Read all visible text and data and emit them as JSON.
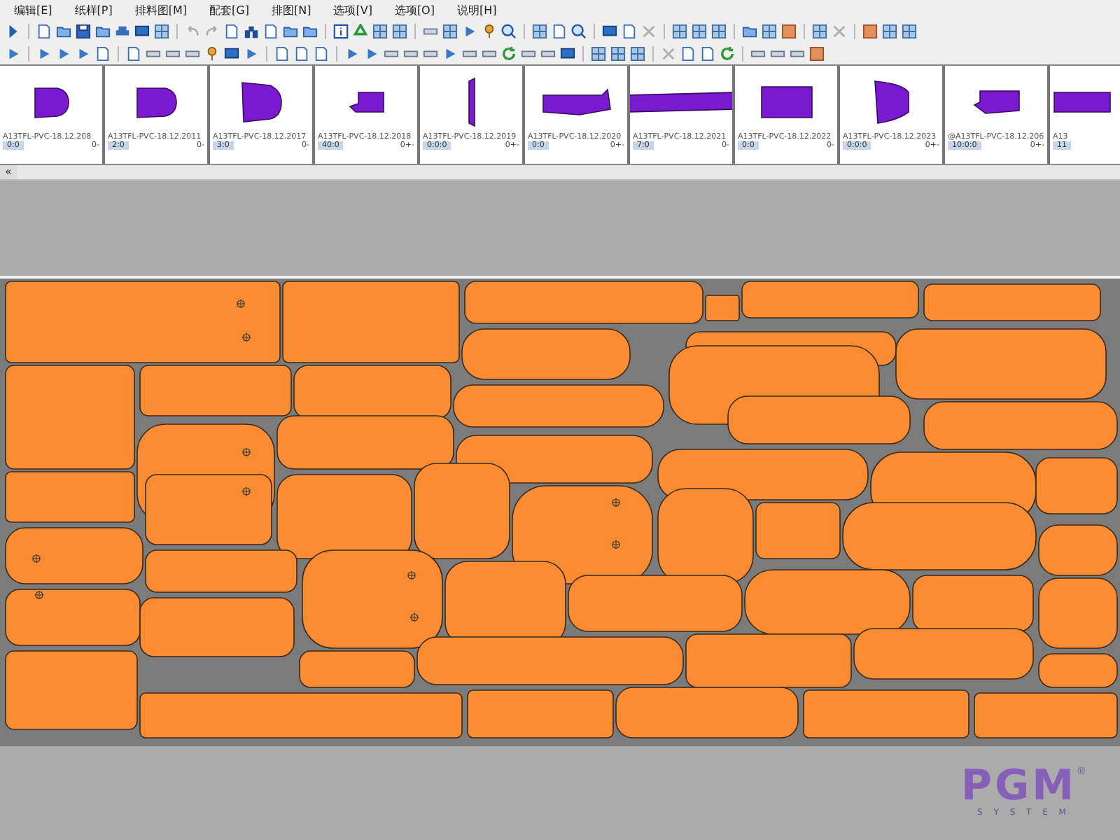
{
  "menu": [
    {
      "label": "编辑[E]"
    },
    {
      "label": "纸样[P]"
    },
    {
      "label": "排料图[M]"
    },
    {
      "label": "配套[G]"
    },
    {
      "label": "排图[N]"
    },
    {
      "label": "选项[V]"
    },
    {
      "label": "选项[O]"
    },
    {
      "label": "说明[H]"
    }
  ],
  "thumbnails": [
    {
      "name": "A13TFL-PVC-18.12.208",
      "count": "0:0",
      "mark": "0-"
    },
    {
      "name": "A13TFL-PVC-18.12.2011",
      "count": "2:0",
      "mark": "0-"
    },
    {
      "name": "A13TFL-PVC-18.12.2017",
      "count": "3:0",
      "mark": "0-"
    },
    {
      "name": "A13TFL-PVC-18.12.2018",
      "count": "40:0",
      "mark": "0+-"
    },
    {
      "name": "A13TFL-PVC-18.12.2019",
      "count": "0:0:0",
      "mark": "0+-"
    },
    {
      "name": "A13TFL-PVC-18.12.2020",
      "count": "0:0",
      "mark": "0+-"
    },
    {
      "name": "A13TFL-PVC-18.12.2021",
      "count": "7:0",
      "mark": "0-"
    },
    {
      "name": "A13TFL-PVC-18.12.2022",
      "count": "0:0",
      "mark": "0-"
    },
    {
      "name": "A13TFL-PVC-18.12.2023",
      "count": "0:0:0",
      "mark": "0+-"
    },
    {
      "name": "@A13TFL-PVC-18.12.206",
      "count": "10:0:0",
      "mark": "0+-"
    },
    {
      "name": "A13",
      "count": "11"
    }
  ],
  "scroll_left": "«",
  "logo": {
    "brand": "PGM",
    "registered": "®",
    "tagline": "S Y S T E M"
  }
}
